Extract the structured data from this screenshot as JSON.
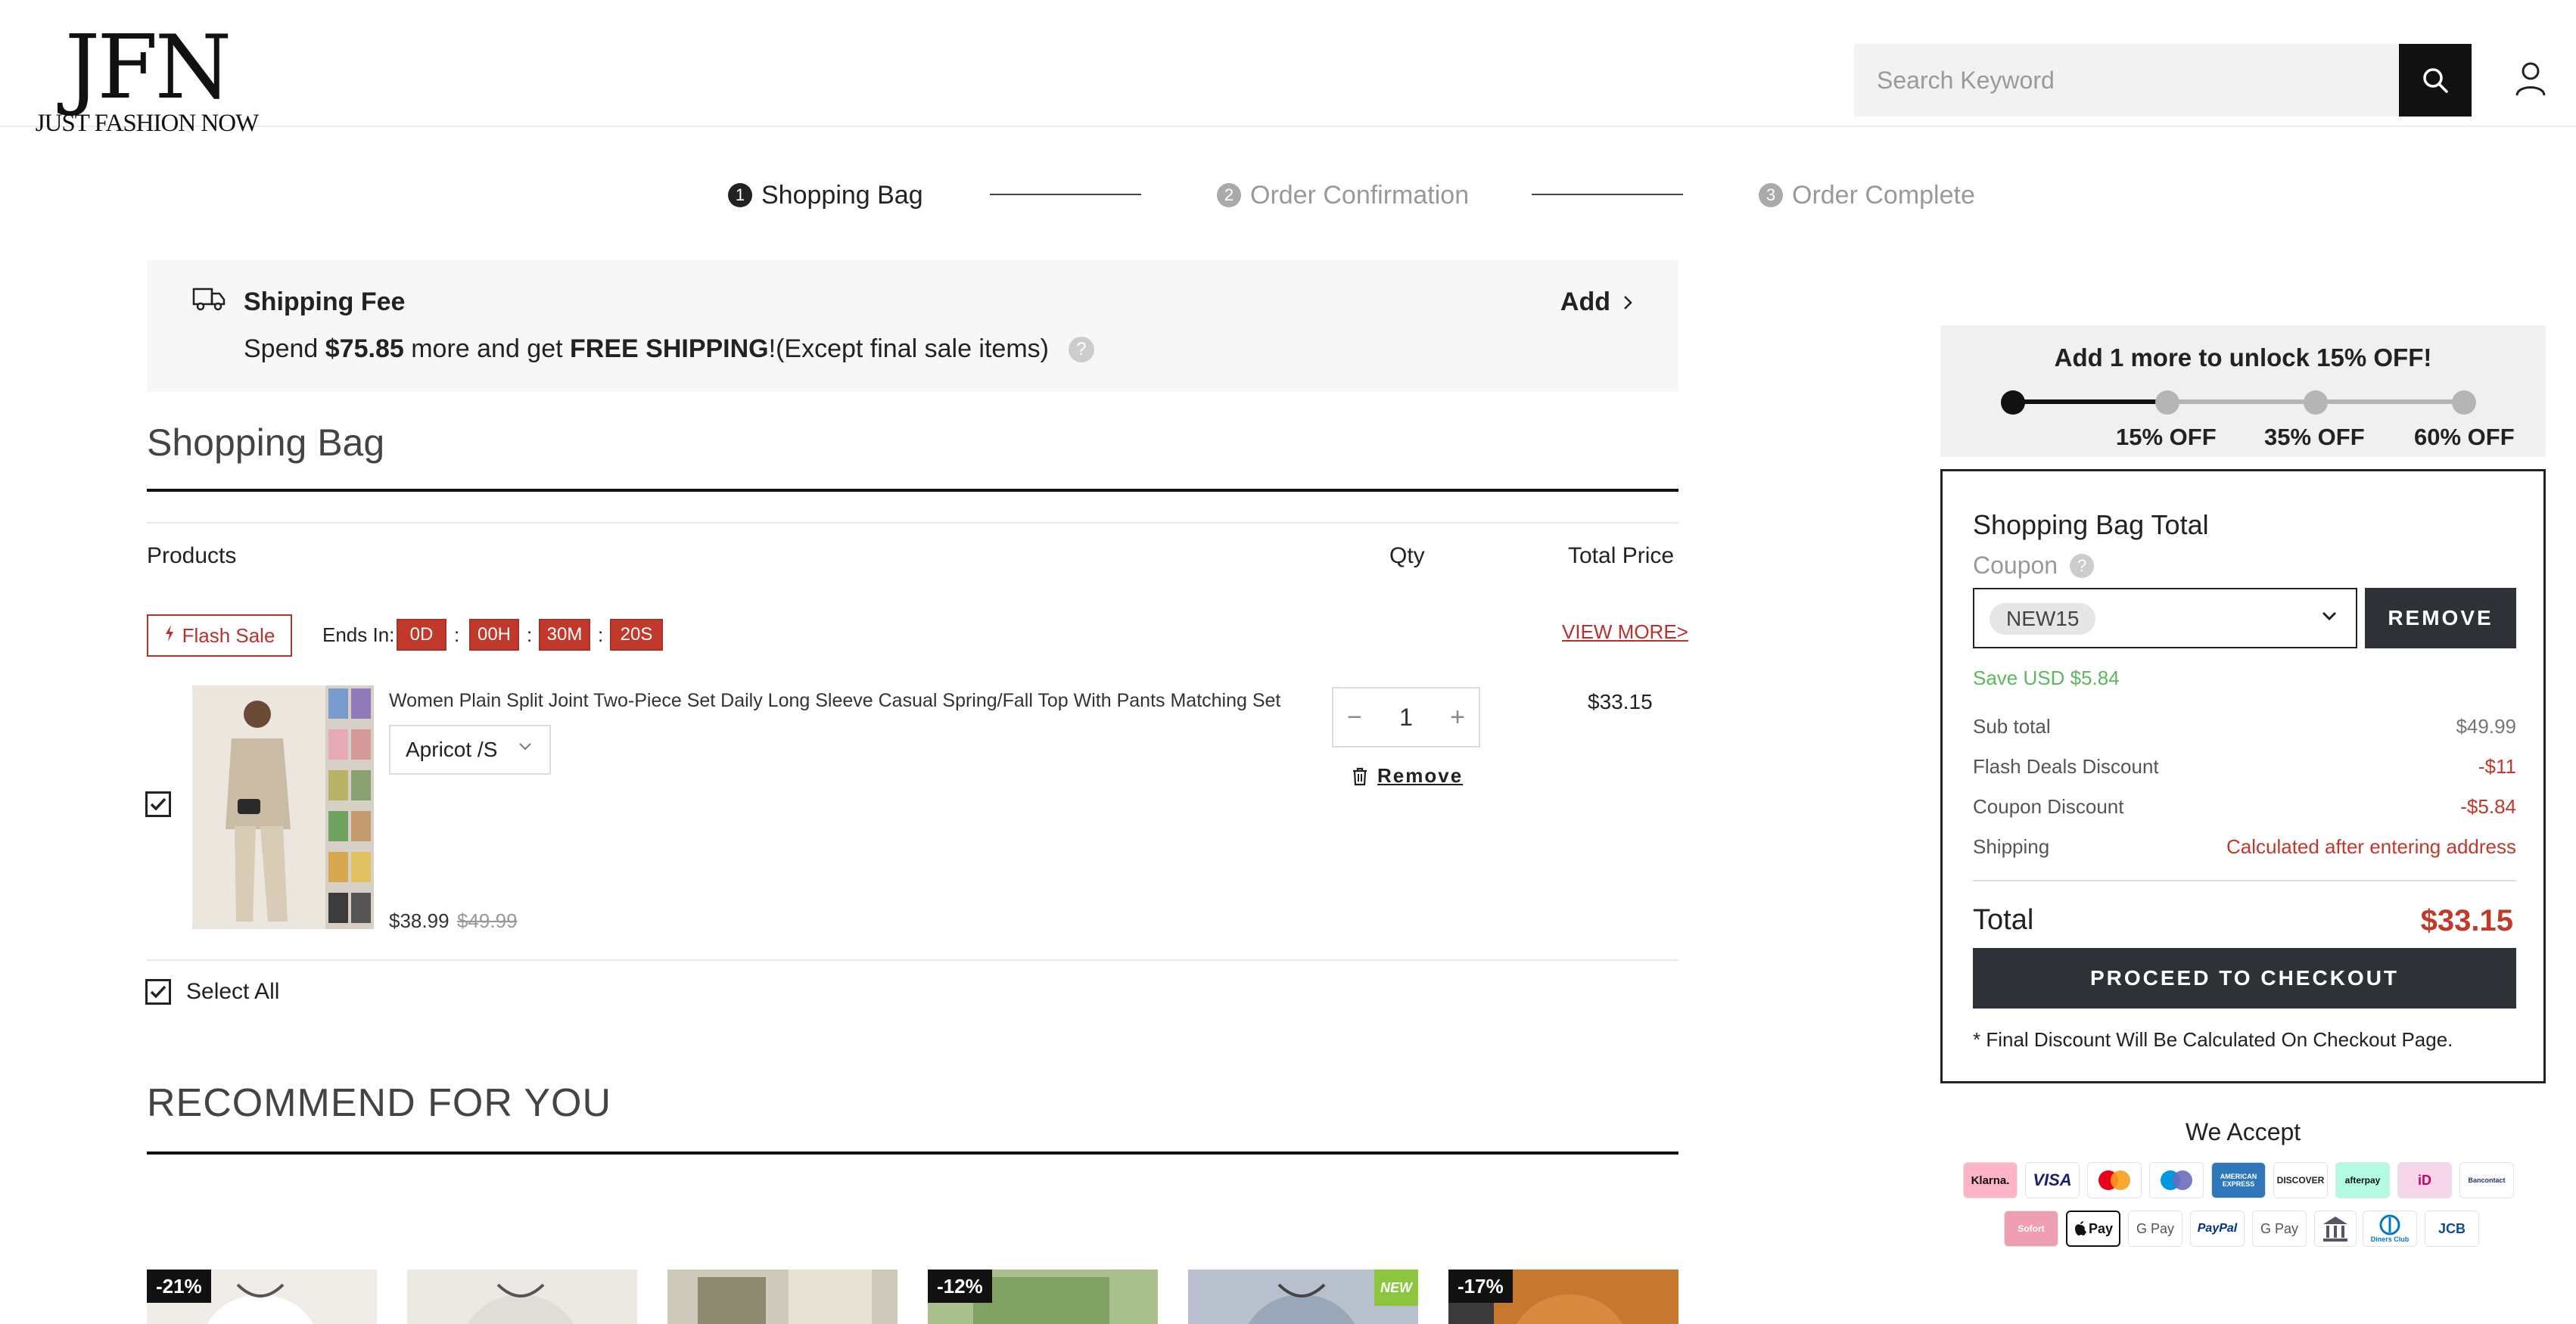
{
  "header": {
    "logo_mark": "JFN",
    "logo_sub": "JUST FASHION NOW",
    "search_placeholder": "Search Keyword"
  },
  "steps": [
    {
      "num": "1",
      "label": "Shopping Bag"
    },
    {
      "num": "2",
      "label": "Order Confirmation"
    },
    {
      "num": "3",
      "label": "Order Complete"
    }
  ],
  "shipping": {
    "title": "Shipping Fee",
    "desc_pre": "Spend ",
    "amount": "$75.85",
    "desc_mid": " more and get ",
    "free": "FREE SHIPPING",
    "desc_post": "!(Except final sale items)",
    "help": "?",
    "add_label": "Add"
  },
  "bag": {
    "title": "Shopping Bag",
    "col_products": "Products",
    "col_qty": "Qty",
    "col_total": "Total Price",
    "flash_label": "Flash Sale",
    "ends_in": "Ends In:",
    "timer": [
      "0D",
      "00H",
      "30M",
      "20S"
    ],
    "sep": ":",
    "view_more": "VIEW MORE>",
    "item": {
      "name": "Women Plain Split Joint Two-Piece Set Daily Long Sleeve Casual Spring/Fall Top With Pants Matching Set",
      "variant": "Apricot /S",
      "price": "$38.99",
      "old_price": "$49.99",
      "qty": "1",
      "minus": "−",
      "plus": "+",
      "remove": "Remove",
      "line_total": "$33.15",
      "checked": true
    },
    "select_all": "Select All"
  },
  "recommend": {
    "title": "RECOMMEND FOR YOU",
    "cards": [
      {
        "badge": "-21%",
        "new": ""
      },
      {
        "badge": "",
        "new": ""
      },
      {
        "badge": "",
        "new": ""
      },
      {
        "badge": "-12%",
        "new": ""
      },
      {
        "badge": "",
        "new": "NEW"
      },
      {
        "badge": "-17%",
        "new": ""
      }
    ]
  },
  "promo": {
    "title": "Add 1 more to unlock 15% OFF!",
    "tiers": [
      "15% OFF",
      "35% OFF",
      "60% OFF"
    ],
    "progress": 0.33
  },
  "summary": {
    "title": "Shopping Bag Total",
    "coupon_label": "Coupon",
    "coupon_help": "?",
    "coupon_code": "NEW15",
    "remove_label": "REMOVE",
    "save_text": "Save USD $5.84",
    "rows": [
      {
        "label": "Sub total",
        "value": "$49.99"
      },
      {
        "label": "Flash Deals Discount",
        "value": "-$11"
      },
      {
        "label": "Coupon Discount",
        "value": "-$5.84"
      },
      {
        "label": "Shipping",
        "value": "Calculated after entering address"
      }
    ],
    "total_label": "Total",
    "total_value": "$33.15",
    "checkout_label": "PROCEED TO CHECKOUT",
    "note": "* Final Discount Will Be Calculated On Checkout Page."
  },
  "payments": {
    "title": "We Accept",
    "row1": [
      "Klarna.",
      "VISA",
      "mastercard",
      "maestro",
      "AMERICAN EXPRESS",
      "DISCOVER",
      "afterpay",
      "iD",
      "Bancontact"
    ],
    "row2": [
      "Sofort",
      "Pay",
      "G Pay",
      "PayPal",
      "G Pay",
      "bank",
      "Diners Club",
      "JCB"
    ]
  },
  "colors": {
    "accent_red": "#c0392b",
    "dark_button": "#2e3136",
    "save_green": "#5cb85c"
  }
}
